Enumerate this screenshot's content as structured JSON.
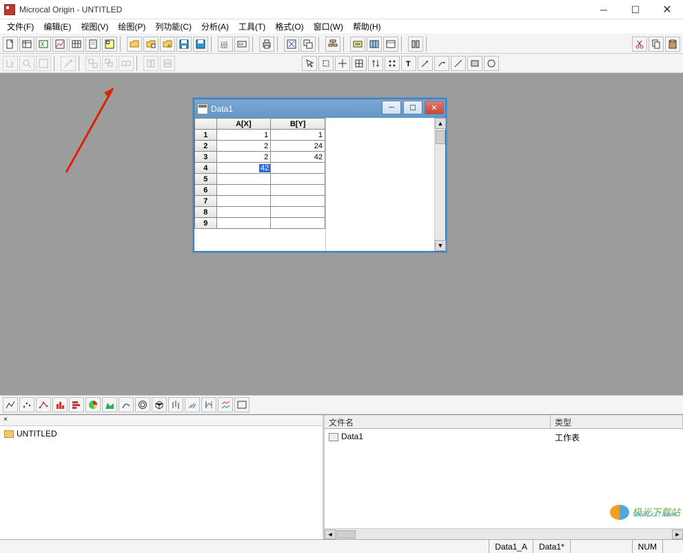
{
  "titlebar": {
    "title": "Microcal Origin - UNTITLED"
  },
  "menu": {
    "items": [
      "文件(F)",
      "编辑(E)",
      "视图(V)",
      "绘图(P)",
      "列功能(C)",
      "分析(A)",
      "工具(T)",
      "格式(O)",
      "窗口(W)",
      "帮助(H)"
    ]
  },
  "data_window": {
    "title": "Data1",
    "columns": [
      "A[X]",
      "B[Y]"
    ],
    "rows": [
      {
        "n": "1",
        "a": "1",
        "b": "1"
      },
      {
        "n": "2",
        "a": "2",
        "b": "24"
      },
      {
        "n": "3",
        "a": "2",
        "b": "42"
      },
      {
        "n": "4",
        "a": "42",
        "b": "",
        "editing": true
      },
      {
        "n": "5",
        "a": "",
        "b": ""
      },
      {
        "n": "6",
        "a": "",
        "b": ""
      },
      {
        "n": "7",
        "a": "",
        "b": ""
      },
      {
        "n": "8",
        "a": "",
        "b": ""
      },
      {
        "n": "9",
        "a": "",
        "b": ""
      }
    ]
  },
  "project_tree": {
    "root": "UNTITLED"
  },
  "file_panel": {
    "name_header": "文件名",
    "type_header": "类型",
    "items": [
      {
        "name": "Data1",
        "type": "工作表"
      }
    ]
  },
  "statusbar": {
    "col": "Data1_A",
    "dataset": "Data1*",
    "mode": "NUM"
  },
  "watermark": {
    "cn": "极光下载站",
    "url": "www.xz7.com"
  }
}
